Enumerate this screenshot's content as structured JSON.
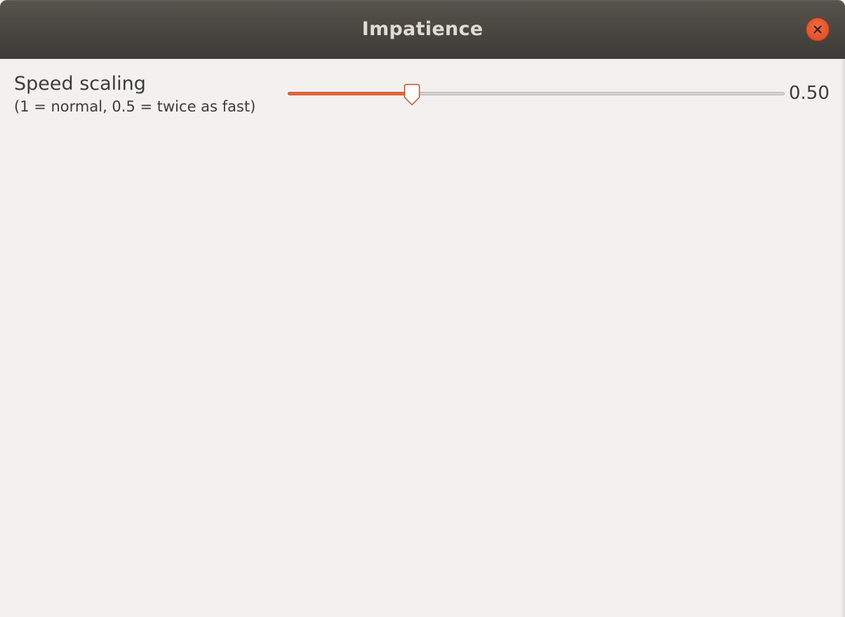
{
  "window": {
    "title": "Impatience",
    "close_icon": "close-icon"
  },
  "setting": {
    "label": "Speed scaling",
    "hint": "(1 = normal, 0.5 = twice as fast)",
    "value_text": "0.50",
    "slider_level": 0.25
  },
  "colors": {
    "accent": "#e9683d",
    "close_button": "#e05a2e",
    "titlebar": "#45423d"
  }
}
